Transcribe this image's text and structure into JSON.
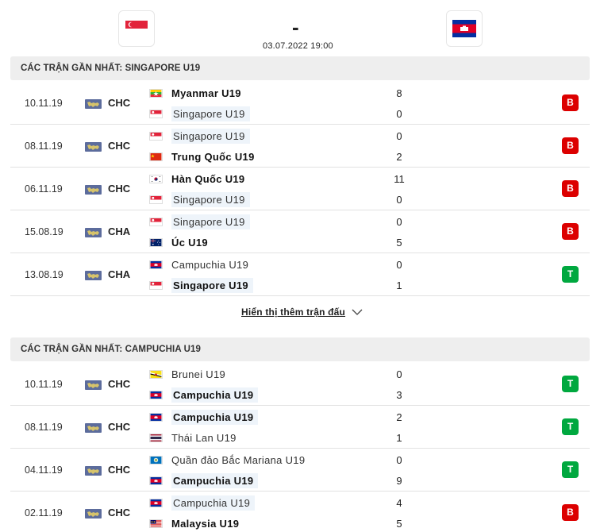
{
  "match": {
    "score": "-",
    "date": "03.07.2022 19:00"
  },
  "colors": {
    "loss": "#dc0000",
    "win": "#00a83f",
    "section_bg": "#eeeeee",
    "highlight_bg": "#eef4fa"
  },
  "sections": [
    {
      "title": "CÁC TRẬN GẦN NHẤT: SINGAPORE U19",
      "rows": [
        {
          "date": "10.11.19",
          "comp": "CHC",
          "team1": "Myanmar U19",
          "flag1": "myanmar",
          "team2": "Singapore U19",
          "flag2": "singapore",
          "score1": "8",
          "score2": "0",
          "result": "B",
          "bold": 1,
          "highlight": 2
        },
        {
          "date": "08.11.19",
          "comp": "CHC",
          "team1": "Singapore U19",
          "flag1": "singapore",
          "team2": "Trung Quốc U19",
          "flag2": "china",
          "score1": "0",
          "score2": "2",
          "result": "B",
          "bold": 2,
          "highlight": 1
        },
        {
          "date": "06.11.19",
          "comp": "CHC",
          "team1": "Hàn Quốc U19",
          "flag1": "korea",
          "team2": "Singapore U19",
          "flag2": "singapore",
          "score1": "11",
          "score2": "0",
          "result": "B",
          "bold": 1,
          "highlight": 2
        },
        {
          "date": "15.08.19",
          "comp": "CHA",
          "team1": "Singapore U19",
          "flag1": "singapore",
          "team2": "Úc U19",
          "flag2": "australia",
          "score1": "0",
          "score2": "5",
          "result": "B",
          "bold": 2,
          "highlight": 1
        },
        {
          "date": "13.08.19",
          "comp": "CHA",
          "team1": "Campuchia U19",
          "flag1": "cambodia",
          "team2": "Singapore U19",
          "flag2": "singapore",
          "score1": "0",
          "score2": "1",
          "result": "T",
          "bold": 2,
          "highlight": 2
        }
      ]
    },
    {
      "title": "CÁC TRẬN GẦN NHẤT: CAMPUCHIA U19",
      "rows": [
        {
          "date": "10.11.19",
          "comp": "CHC",
          "team1": "Brunei U19",
          "flag1": "brunei",
          "team2": "Campuchia U19",
          "flag2": "cambodia",
          "score1": "0",
          "score2": "3",
          "result": "T",
          "bold": 2,
          "highlight": 2
        },
        {
          "date": "08.11.19",
          "comp": "CHC",
          "team1": "Campuchia U19",
          "flag1": "cambodia",
          "team2": "Thái Lan U19",
          "flag2": "thailand",
          "score1": "2",
          "score2": "1",
          "result": "T",
          "bold": 1,
          "highlight": 1
        },
        {
          "date": "04.11.19",
          "comp": "CHC",
          "team1": "Quần đảo Bắc Mariana U19",
          "flag1": "mariana",
          "team2": "Campuchia U19",
          "flag2": "cambodia",
          "score1": "0",
          "score2": "9",
          "result": "T",
          "bold": 2,
          "highlight": 2
        },
        {
          "date": "02.11.19",
          "comp": "CHC",
          "team1": "Campuchia U19",
          "flag1": "cambodia",
          "team2": "Malaysia U19",
          "flag2": "malaysia",
          "score1": "4",
          "score2": "5",
          "result": "B",
          "bold": 2,
          "highlight": 1
        }
      ]
    }
  ],
  "show_more_label": "Hiển thị thêm trận đấu"
}
